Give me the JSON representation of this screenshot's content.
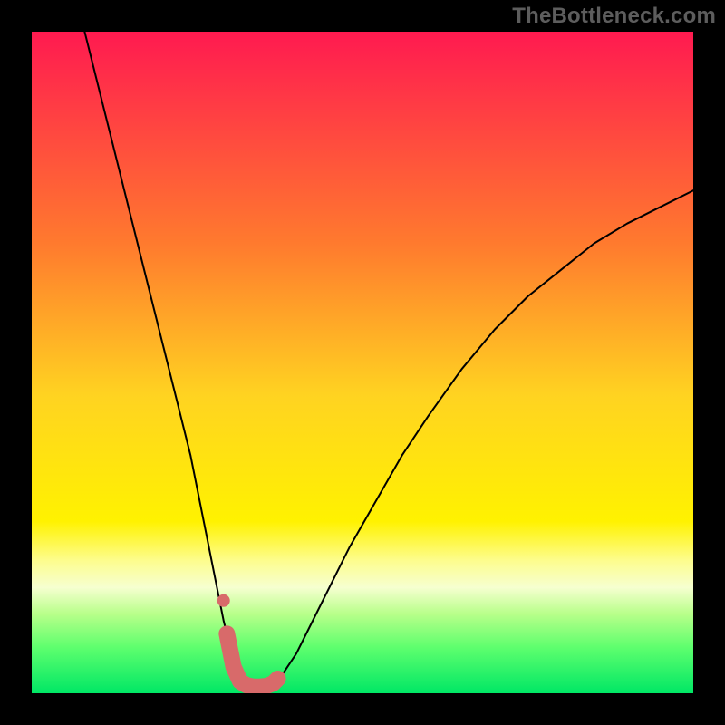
{
  "attribution": "TheBottleneck.com",
  "chart_data": {
    "type": "line",
    "title": "",
    "xlabel": "",
    "ylabel": "",
    "xlim": [
      0,
      100
    ],
    "ylim": [
      0,
      100
    ],
    "background": {
      "type": "vertical-gradient",
      "stops": [
        {
          "offset": 0.0,
          "color": "#ff1a50"
        },
        {
          "offset": 0.32,
          "color": "#ff7a2e"
        },
        {
          "offset": 0.55,
          "color": "#ffd321"
        },
        {
          "offset": 0.74,
          "color": "#fff200"
        },
        {
          "offset": 0.8,
          "color": "#fdfd8f"
        },
        {
          "offset": 0.84,
          "color": "#f6ffd0"
        },
        {
          "offset": 0.88,
          "color": "#b8ff8a"
        },
        {
          "offset": 0.93,
          "color": "#5fff6e"
        },
        {
          "offset": 1.0,
          "color": "#00e765"
        }
      ]
    },
    "series": [
      {
        "name": "bottleneck-curve",
        "color": "#000000",
        "stroke_width": 2,
        "x": [
          8,
          10,
          12,
          14,
          16,
          18,
          20,
          22,
          24,
          26,
          27,
          28,
          29,
          30,
          31,
          32,
          33,
          34,
          35,
          36,
          37,
          38,
          40,
          42,
          45,
          48,
          52,
          56,
          60,
          65,
          70,
          75,
          80,
          85,
          90,
          95,
          100
        ],
        "y": [
          100,
          92,
          84,
          76,
          68,
          60,
          52,
          44,
          36,
          26,
          21,
          16,
          11,
          7,
          4,
          2.2,
          1.4,
          1.0,
          1.0,
          1.2,
          1.8,
          3,
          6,
          10,
          16,
          22,
          29,
          36,
          42,
          49,
          55,
          60,
          64,
          68,
          71,
          73.5,
          76
        ]
      }
    ],
    "highlight": {
      "name": "optimum-band",
      "color": "#d86a6a",
      "x": [
        29.5,
        30.5,
        31.5,
        32.5,
        33.5,
        34.5,
        35.5,
        36.5,
        37.2
      ],
      "y": [
        9.0,
        4.0,
        1.8,
        1.2,
        1.0,
        1.0,
        1.1,
        1.5,
        2.2
      ],
      "dot_radius_px": 9,
      "extra_dot": {
        "x": 29.0,
        "y": 14.0,
        "radius_px": 7
      }
    }
  }
}
